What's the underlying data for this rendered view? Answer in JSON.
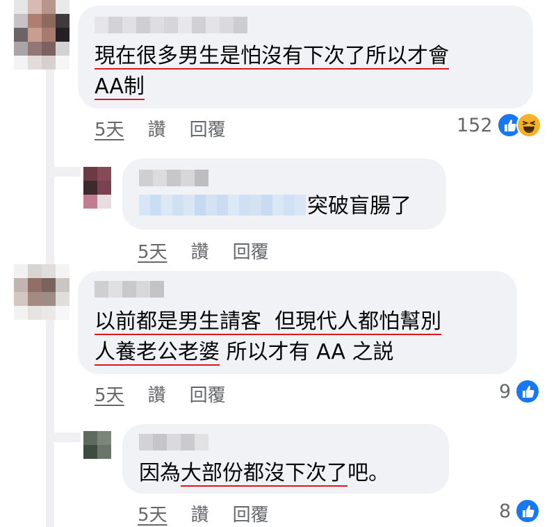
{
  "colors": {
    "bubble": "#f0f2f5",
    "underline": "#e0141d",
    "meta": "#65676b",
    "like": "#1877f2",
    "haha": "#f7b125"
  },
  "comments": [
    {
      "level": 0,
      "text_line1": "現在很多男生是怕沒有下次了所以才會",
      "text_line2": "AA制",
      "time": "5天",
      "like_label": "讚",
      "reply_label": "回覆",
      "reaction_count": "152",
      "reactions": [
        "like-icon",
        "haha-icon"
      ]
    },
    {
      "level": 1,
      "text_line1": "突破盲腸了",
      "time": "5天",
      "like_label": "讚",
      "reply_label": "回覆"
    },
    {
      "level": 0,
      "text_line1_u1": "以前都是男生請客",
      "text_line1_u2": "但現代人都怕幫別",
      "text_line2_u": "人養老公老婆",
      "text_line2_rest": " 所以才有 AA 之説",
      "time": "5天",
      "like_label": "讚",
      "reply_label": "回覆",
      "reaction_count": "9",
      "reactions": [
        "like-icon"
      ]
    },
    {
      "level": 1,
      "text_a": "因為",
      "text_u": "大部份都沒下次了",
      "text_b": "吧。",
      "time": "5天",
      "like_label": "讚",
      "reply_label": "回覆",
      "reaction_count": "8",
      "reactions": [
        "like-icon"
      ]
    }
  ]
}
